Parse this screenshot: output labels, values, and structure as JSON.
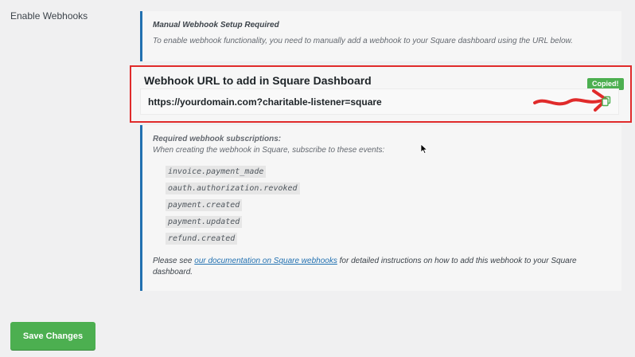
{
  "settings": {
    "field_label": "Enable Webhooks"
  },
  "notice": {
    "title": "Manual Webhook Setup Required",
    "text": "To enable webhook functionality, you need to manually add a webhook to your Square dashboard using the URL below."
  },
  "webhook_url": {
    "title": "Webhook URL to add in Square Dashboard",
    "value": "https://yourdomain.com?charitable-listener=square",
    "copied_badge": "Copied!",
    "copy_icon": "copy-icon"
  },
  "subscriptions": {
    "title": "Required webhook subscriptions:",
    "description": "When creating the webhook in Square, subscribe to these events:",
    "events": [
      "invoice.payment_made",
      "oauth.authorization.revoked",
      "payment.created",
      "payment.updated",
      "refund.created"
    ],
    "docs_prefix": "Please see ",
    "docs_link": "our documentation on Square webhooks",
    "docs_suffix": " for detailed instructions on how to add this webhook to your Square dashboard."
  },
  "actions": {
    "save_label": "Save Changes"
  },
  "colors": {
    "accent_blue": "#2271b1",
    "highlight_red": "#e02b2b",
    "success_green": "#4caf50"
  }
}
